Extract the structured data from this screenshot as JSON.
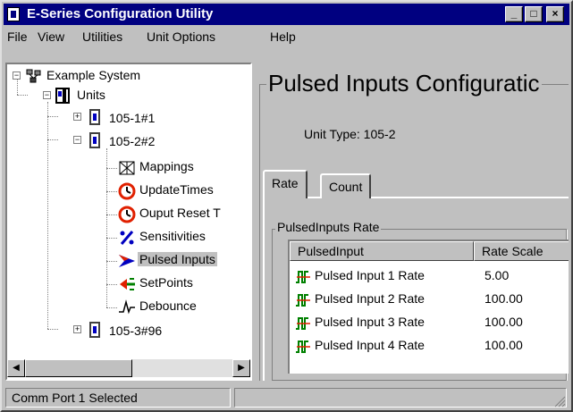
{
  "window": {
    "title": "E-Series Configuration Utility",
    "controls": {
      "minimize": "_",
      "maximize": "□",
      "close": "×"
    }
  },
  "menu": {
    "items": [
      {
        "label": "File"
      },
      {
        "label": "View"
      },
      {
        "label": "Utilities"
      },
      {
        "label": "Unit Options"
      },
      {
        "label": "Help"
      }
    ]
  },
  "tree": {
    "root": {
      "label": "Example System",
      "icon": "network-icon"
    },
    "units": {
      "label": "Units",
      "icon": "units-icon"
    },
    "unit1": {
      "label": "105-1#1",
      "icon": "unit-icon"
    },
    "unit2": {
      "label": "105-2#2",
      "icon": "unit-icon"
    },
    "children": [
      {
        "label": "Mappings",
        "icon": "mappings-icon"
      },
      {
        "label": "UpdateTimes",
        "icon": "clock-icon"
      },
      {
        "label": "Ouput Reset T",
        "icon": "clock-icon"
      },
      {
        "label": "Sensitivities",
        "icon": "percent-icon"
      },
      {
        "label": "Pulsed Inputs",
        "icon": "arrow-icon"
      },
      {
        "label": "SetPoints",
        "icon": "setpoint-icon"
      },
      {
        "label": "Debounce",
        "icon": "wave-icon"
      }
    ],
    "unit3": {
      "label": "105-3#96",
      "icon": "unit-icon"
    },
    "selected": "Pulsed Inputs"
  },
  "main": {
    "title": "Pulsed Inputs Configuratic",
    "unit_type_label": "Unit Type:",
    "unit_type_value": "105-2",
    "tabs": [
      {
        "label": "Rate",
        "active": true
      },
      {
        "label": "Count",
        "active": false
      }
    ],
    "group_title": "PulsedInputs Rate",
    "columns": [
      "PulsedInput",
      "Rate Scale"
    ],
    "rows": [
      {
        "name": "Pulsed Input 1 Rate",
        "value": "5.00"
      },
      {
        "name": "Pulsed Input 2 Rate",
        "value": "100.00"
      },
      {
        "name": "Pulsed Input 3 Rate",
        "value": "100.00"
      },
      {
        "name": "Pulsed Input 4 Rate",
        "value": "100.00"
      }
    ]
  },
  "status": {
    "text": "Comm Port 1 Selected"
  },
  "colors": {
    "titlebar": "#000080",
    "face": "#c0c0c0",
    "accent_red": "#e02000",
    "accent_blue": "#0000c0"
  }
}
